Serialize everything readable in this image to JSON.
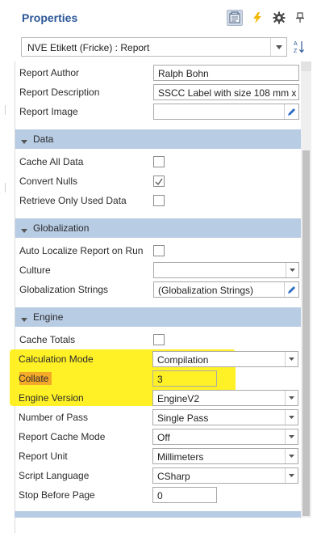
{
  "header": {
    "title": "Properties"
  },
  "object_selector": {
    "value": "NVE Etikett (Fricke) : Report"
  },
  "rows_top": [
    {
      "label": "Report Author",
      "value": "Ralph Bohn"
    },
    {
      "label": "Report Description",
      "value": "SSCC Label with size 108 mm x"
    },
    {
      "label": "Report Image",
      "value": ""
    }
  ],
  "categories": {
    "data": "Data",
    "globalization": "Globalization",
    "engine": "Engine"
  },
  "data_rows": [
    {
      "label": "Cache All Data",
      "checked": false
    },
    {
      "label": "Convert Nulls",
      "checked": true
    },
    {
      "label": "Retrieve Only Used Data",
      "checked": false
    }
  ],
  "globalization_rows": [
    {
      "label": "Auto Localize Report on Run",
      "checked": false
    },
    {
      "label": "Culture",
      "value": ""
    },
    {
      "label": "Globalization Strings",
      "value": "(Globalization Strings)"
    }
  ],
  "engine_rows": [
    {
      "label": "Cache Totals",
      "checked": false
    },
    {
      "label": "Calculation Mode",
      "value": "Compilation"
    },
    {
      "label": "Collate",
      "value": "3"
    },
    {
      "label": "Engine Version",
      "value": "EngineV2"
    },
    {
      "label": "Number of Pass",
      "value": "Single Pass"
    },
    {
      "label": "Report Cache Mode",
      "value": "Off"
    },
    {
      "label": "Report Unit",
      "value": "Millimeters"
    },
    {
      "label": "Script Language",
      "value": "CSharp"
    },
    {
      "label": "Stop Before Page",
      "value": "0"
    }
  ],
  "colors": {
    "title": "#2b5797",
    "category_band": "#b8cce4",
    "highlight": "#ffef00",
    "collate_highlight": "#f4a12a",
    "lightning_icon": "#f2b705"
  }
}
